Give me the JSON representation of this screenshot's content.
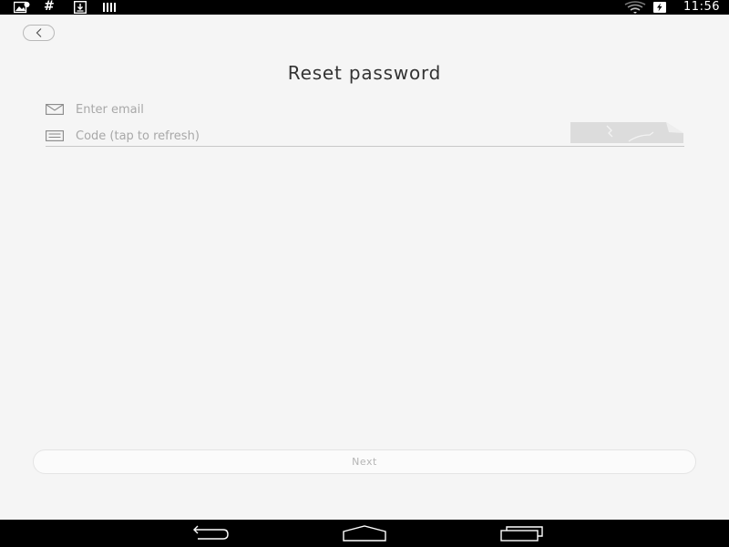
{
  "status_bar": {
    "time": "11:56",
    "hash_glyph": "#",
    "icons": [
      "image-notification-icon",
      "hash-icon",
      "download-icon",
      "barcode-icon",
      "wifi-icon",
      "battery-icon"
    ]
  },
  "header": {
    "title": "Reset password",
    "back_icon": "chevron-left-icon"
  },
  "form": {
    "email": {
      "placeholder": "Enter email",
      "value": "",
      "icon": "envelope-icon"
    },
    "code": {
      "placeholder": "Code (tap to refresh)",
      "value": "",
      "icon": "keyboard-icon"
    },
    "captcha": {
      "icon": "captcha-image"
    }
  },
  "actions": {
    "next_label": "Next"
  },
  "nav_bar": {
    "icons": [
      "back-nav-icon",
      "home-nav-icon",
      "recents-nav-icon"
    ]
  },
  "colors": {
    "background": "#f5f5f5",
    "system_bars": "#000000",
    "title_text": "#333333",
    "placeholder_text": "#a8a8a8",
    "button_text": "#b5b5b5"
  }
}
